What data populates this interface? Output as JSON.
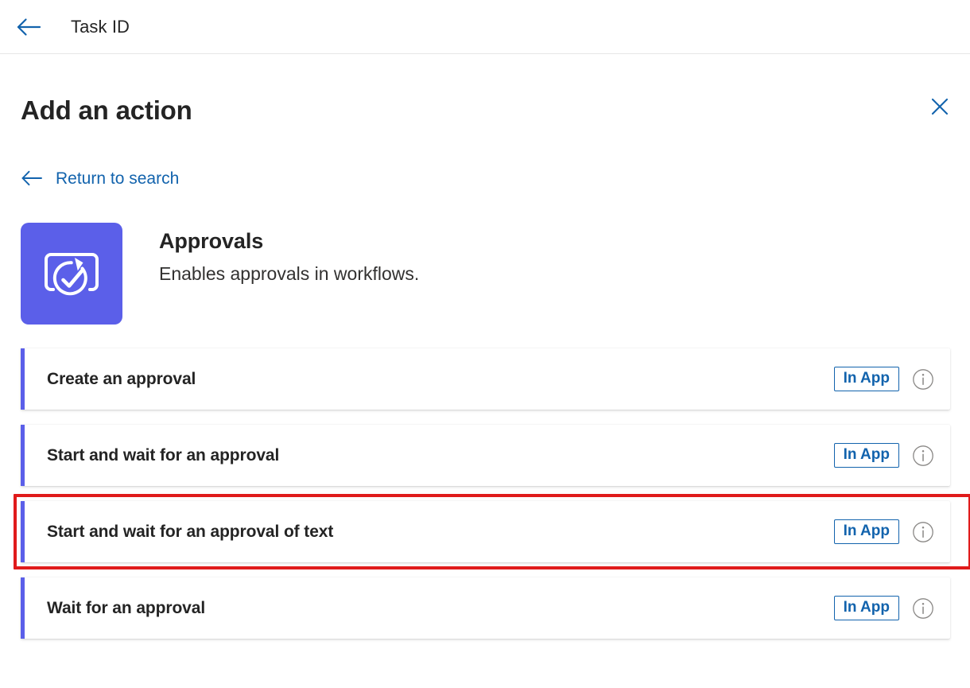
{
  "topbar": {
    "back_icon": "arrow-left-icon",
    "title": "Task ID"
  },
  "panel": {
    "title": "Add an action",
    "close_icon": "close-icon",
    "return_link": {
      "icon": "arrow-left-icon",
      "label": "Return to search"
    }
  },
  "connector": {
    "icon": "approvals-icon",
    "name": "Approvals",
    "description": "Enables approvals in workflows."
  },
  "actions": [
    {
      "label": "Create an approval",
      "badge": "In App",
      "info_icon": "info-icon",
      "highlighted": false
    },
    {
      "label": "Start and wait for an approval",
      "badge": "In App",
      "info_icon": "info-icon",
      "highlighted": false
    },
    {
      "label": "Start and wait for an approval of text",
      "badge": "In App",
      "info_icon": "info-icon",
      "highlighted": true
    },
    {
      "label": "Wait for an approval",
      "badge": "In App",
      "info_icon": "info-icon",
      "highlighted": false
    }
  ],
  "colors": {
    "accent_purple": "#5b5fe9",
    "link_blue": "#1263ad",
    "highlight_red": "#e01b1b",
    "text_primary": "#242424",
    "info_gray": "#8a8886"
  }
}
